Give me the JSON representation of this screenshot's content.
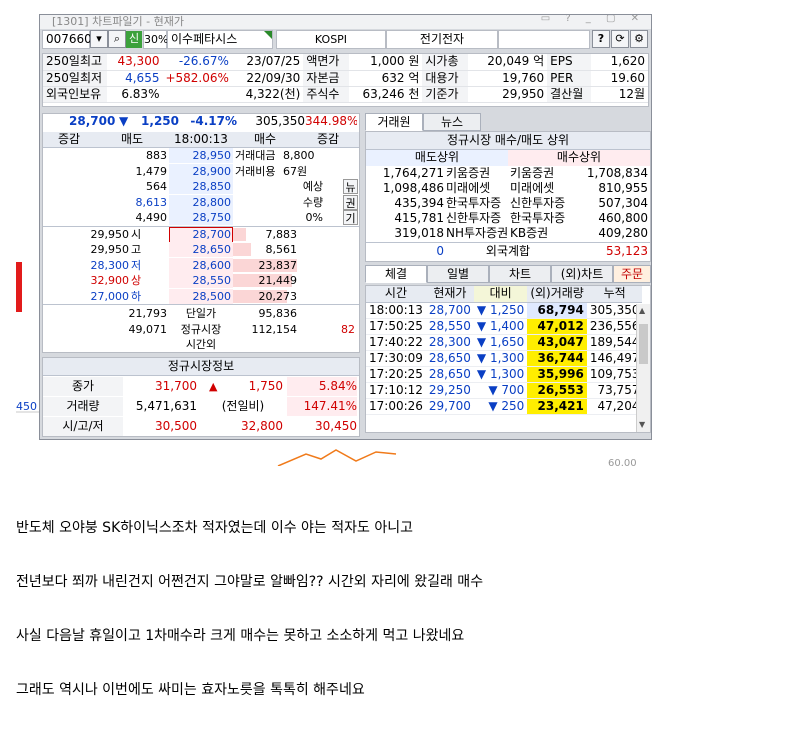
{
  "window": {
    "title": "[1301] 차트파일기 - 현재가"
  },
  "toolbar": {
    "code": "007660",
    "credit_badge": "신",
    "margin": "30%",
    "name": "이수페타시스",
    "market": "KOSPI",
    "sector": "전기전자"
  },
  "info_rows": [
    {
      "label": "250일최고",
      "value": "43,300",
      "pct": "-26.67%",
      "date": "23/07/25",
      "k1": "액면가",
      "v1": "1,000 원",
      "k2": "시가총",
      "v2": "20,049 억",
      "k3": "EPS",
      "v3": "1,620"
    },
    {
      "label": "250일최저",
      "value": "4,655",
      "pct": "+582.06%",
      "date": "22/09/30",
      "k1": "자본금",
      "v1": "632 억",
      "k2": "대용가",
      "v2": "19,760",
      "k3": "PER",
      "v3": "19.60"
    },
    {
      "label": "외국인보유",
      "value": "6.83%",
      "pct": "",
      "date": "4,322(천)",
      "k1": "주식수",
      "v1": "63,246 천",
      "k2": "기준가",
      "v2": "29,950",
      "k3": "결산월",
      "v3": "12월"
    }
  ],
  "quote": {
    "price": "28,700",
    "arrow": "▼",
    "change": "1,250",
    "pct": "-4.17%",
    "volume": "305,350",
    "vol_ratio": "344.98%"
  },
  "orderbook": {
    "headers": [
      "증감",
      "매도",
      "18:00:13",
      "매수",
      "증감"
    ],
    "asks": [
      {
        "qty": "883",
        "price": "28,950"
      },
      {
        "qty": "1,479",
        "price": "28,900"
      },
      {
        "qty": "564",
        "price": "28,850"
      },
      {
        "qty": "8,613",
        "price": "28,800"
      },
      {
        "qty": "4,490",
        "price": "28,750"
      }
    ],
    "bids": [
      {
        "price": "28,700",
        "qty": "7,883"
      },
      {
        "price": "28,650",
        "qty": "8,561"
      },
      {
        "price": "28,600",
        "qty": "23,837"
      },
      {
        "price": "28,550",
        "qty": "21,449"
      },
      {
        "price": "28,500",
        "qty": "20,273"
      }
    ],
    "left_info": [
      {
        "value": "29,950",
        "tag": "시"
      },
      {
        "value": "29,950",
        "tag": "고"
      },
      {
        "value": "28,300",
        "tag": "저"
      },
      {
        "value": "32,900",
        "tag": "상"
      },
      {
        "value": "27,000",
        "tag": "하"
      }
    ],
    "deal_amount_label": "거래대금",
    "deal_amount": "8,800",
    "deal_cost_label": "거래비용",
    "deal_cost": "67원",
    "expected_label": "예상",
    "qty_label": "수량",
    "qty_pct": "0%",
    "side_tabs": [
      "뉴",
      "권",
      "기"
    ],
    "total_ask": "21,793",
    "total_bid": "95,836",
    "single_label": "단일가",
    "after_ask": "49,071",
    "after_label1": "정규시장",
    "after_label2": "시간외",
    "after_bid": "112,154",
    "after_diff": "82"
  },
  "regular": {
    "title": "정규시장정보",
    "rows": [
      {
        "k": "종가",
        "v1": "31,700",
        "arrow": "▲",
        "v2": "1,750",
        "v3": "5.84%"
      },
      {
        "k": "거래량",
        "v1": "5,471,631",
        "v2": "(전일비)",
        "v3": "147.41%"
      },
      {
        "k": "시/고/저",
        "v1": "30,500",
        "v2": "32,800",
        "v3": "30,450"
      }
    ]
  },
  "right_tabs": [
    "거래원",
    "뉴스"
  ],
  "brokers": {
    "title": "정규시장 매수/매도 상위",
    "sell_header": "매도상위",
    "buy_header": "매수상위",
    "rows": [
      {
        "sq": "1,764,271",
        "sn": "키움증권",
        "bn": "키움증권",
        "bq": "1,708,834"
      },
      {
        "sq": "1,098,486",
        "sn": "미래에셋",
        "bn": "미래에셋",
        "bq": "810,955"
      },
      {
        "sq": "435,394",
        "sn": "한국투자증",
        "bn": "신한투자증",
        "bq": "507,304"
      },
      {
        "sq": "415,781",
        "sn": "신한투자증",
        "bn": "한국투자증",
        "bq": "460,800"
      },
      {
        "sq": "319,018",
        "sn": "NH투자증권",
        "bn": "KB증권",
        "bq": "409,280"
      }
    ],
    "foreign_left": "0",
    "foreign_label": "외국계합",
    "foreign_right": "53,123"
  },
  "trade_tabs": [
    "체결",
    "일별",
    "차트",
    "(외)차트",
    "주문"
  ],
  "ticks": {
    "headers": [
      "시간",
      "현재가",
      "대비",
      "(외)거래량",
      "누적"
    ],
    "rows": [
      {
        "t": "18:00:13",
        "p": "28,700",
        "d": "▼ 1,250",
        "v": "68,794",
        "c": "305,350"
      },
      {
        "t": "17:50:25",
        "p": "28,550",
        "d": "▼ 1,400",
        "v": "47,012",
        "c": "236,556"
      },
      {
        "t": "17:40:22",
        "p": "28,300",
        "d": "▼ 1,650",
        "v": "43,047",
        "c": "189,544"
      },
      {
        "t": "17:30:09",
        "p": "28,650",
        "d": "▼ 1,300",
        "v": "36,744",
        "c": "146,497"
      },
      {
        "t": "17:20:25",
        "p": "28,650",
        "d": "▼ 1,300",
        "v": "35,996",
        "c": "109,753"
      },
      {
        "t": "17:10:12",
        "p": "29,250",
        "d": "▼ 700",
        "v": "26,553",
        "c": "73,757"
      },
      {
        "t": "17:00:26",
        "p": "29,700",
        "d": "▼ 250",
        "v": "23,421",
        "c": "47,204"
      }
    ]
  },
  "bg": {
    "left_value": "450",
    "right_value": "60.00"
  },
  "blog": [
    "반도체 오야붕 SK하이닉스조차 적자였는데 이수 야는 적자도 아니고",
    "전년보다 쬐까 내린건지 어쩐건지 그야말로 알빠임?? 시간외 자리에 왔길래 매수",
    "사실 다음날 휴일이고 1차매수라 크게 매수는 못하고  소소하게 먹고 나왔네요",
    "그래도 역시나 이번에도 싸미는 효자노릇을 톡톡히 해주네요"
  ]
}
